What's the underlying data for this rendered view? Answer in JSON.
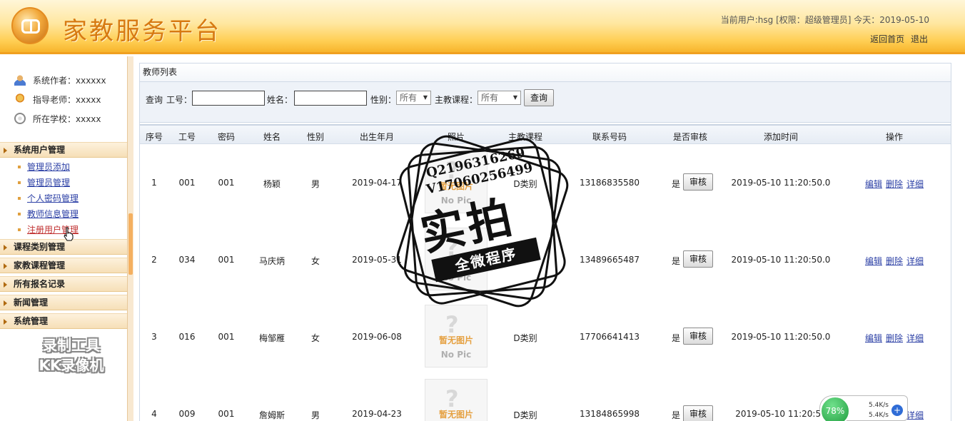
{
  "header": {
    "title": "家教服务平台",
    "user_info": "当前用户:hsg [权限：超级管理员] 今天：2019-05-10",
    "home_link": "返回首页",
    "logout_link": "退出"
  },
  "sidebar": {
    "info": [
      {
        "label": "系统作者：xxxxxx",
        "icon": "user-icon"
      },
      {
        "label": "指导老师：xxxxx",
        "icon": "teacher-icon"
      },
      {
        "label": "所在学校：xxxxx",
        "icon": "school-icon"
      }
    ],
    "groups": [
      {
        "label": "系统用户管理",
        "items": [
          "管理员添加",
          "管理员管理",
          "个人密码管理",
          "教师信息管理",
          "注册用户管理"
        ]
      },
      {
        "label": "课程类别管理"
      },
      {
        "label": "家教课程管理"
      },
      {
        "label": "所有报名记录"
      },
      {
        "label": "新闻管理"
      },
      {
        "label": "系统管理"
      }
    ],
    "watermark": [
      "录制工具",
      "KK录像机"
    ]
  },
  "panel": {
    "title": "教师列表",
    "search": {
      "query_label": "查询",
      "id_label": "工号：",
      "id_value": "",
      "name_label": "姓名：",
      "name_value": "",
      "gender_label": "性别：",
      "gender_value": "所有",
      "course_label": "主教课程：",
      "course_value": "所有",
      "submit_label": "查询"
    }
  },
  "table": {
    "headers": [
      "序号",
      "工号",
      "密码",
      "姓名",
      "性别",
      "出生年月",
      "照片",
      "主教课程",
      "联系号码",
      "是否审核",
      "添加时间",
      "操作"
    ],
    "rows": [
      {
        "no": "1",
        "id": "001",
        "pwd": "001",
        "name": "杨颖",
        "gender": "男",
        "birth": "2019-04-17",
        "course": "D类别",
        "phone": "13186835580",
        "approved": "是",
        "added": "2019-05-10 11:20:50.0"
      },
      {
        "no": "2",
        "id": "034",
        "pwd": "001",
        "name": "马庆炳",
        "gender": "女",
        "birth": "2019-05-31",
        "course": "",
        "phone": "13489665487",
        "approved": "是",
        "added": "2019-05-10 11:20:50.0"
      },
      {
        "no": "3",
        "id": "016",
        "pwd": "001",
        "name": "梅邹雁",
        "gender": "女",
        "birth": "2019-06-08",
        "course": "D类别",
        "phone": "17706641413",
        "approved": "是",
        "added": "2019-05-10 11:20:50.0"
      },
      {
        "no": "4",
        "id": "009",
        "pwd": "001",
        "name": "詹姆斯",
        "gender": "男",
        "birth": "2019-04-23",
        "course": "D类别",
        "phone": "13184865998",
        "approved": "是",
        "added": "2019-05-10 11:20:50"
      }
    ],
    "review_button": "审核",
    "ops": [
      "编辑",
      "删除",
      "详细"
    ],
    "no_pic_cn": "暂无图片",
    "no_pic_en": "No Pic"
  },
  "stamp": {
    "line1": "Q2196316269",
    "line2": "V17060256499",
    "big": "实拍",
    "ribbon": "全微程序"
  },
  "speed_widget": {
    "percent": "78%",
    "up": "5.4K/s",
    "down": "5.4K/s"
  }
}
